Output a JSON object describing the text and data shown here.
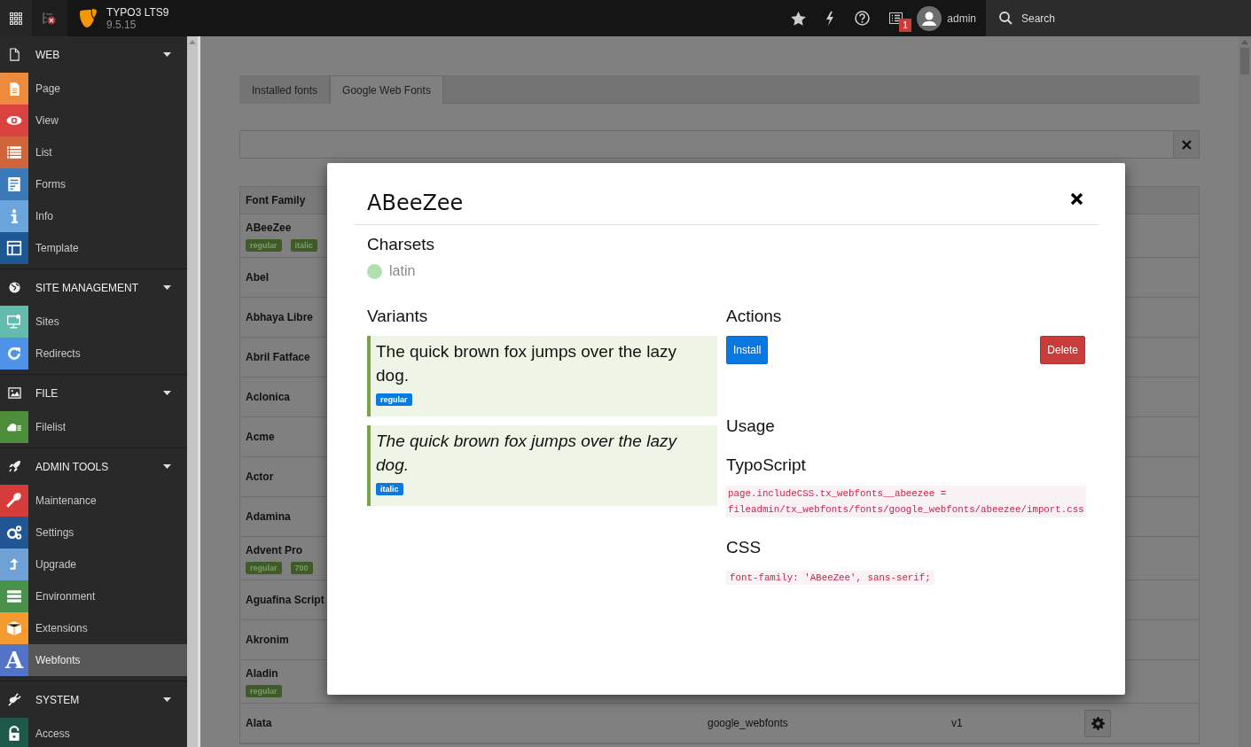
{
  "topbar": {
    "app_title": "TYPO3 LTS9",
    "version": "9.5.15",
    "notification_count": "1",
    "user": "admin",
    "search_label": "Search"
  },
  "sidebar": {
    "groups": [
      {
        "label": "WEB",
        "expanded": true,
        "items": [
          {
            "label": "Page",
            "selected": false,
            "color": "#ee8a3b"
          },
          {
            "label": "View",
            "selected": false,
            "color": "#d9423f"
          },
          {
            "label": "List",
            "selected": false,
            "color": "#d0653c"
          },
          {
            "label": "Forms",
            "selected": false,
            "color": "#3a7ab8"
          },
          {
            "label": "Info",
            "selected": false,
            "color": "#6aa5dd"
          },
          {
            "label": "Template",
            "selected": false,
            "color": "#1d5895"
          }
        ]
      },
      {
        "label": "SITE MANAGEMENT",
        "expanded": true,
        "items": [
          {
            "label": "Sites",
            "selected": false,
            "color": "#63bbad"
          },
          {
            "label": "Redirects",
            "selected": false,
            "color": "#4f93e8"
          }
        ]
      },
      {
        "label": "FILE",
        "expanded": true,
        "items": [
          {
            "label": "Filelist",
            "selected": false,
            "color": "#4e8d3a"
          }
        ]
      },
      {
        "label": "ADMIN TOOLS",
        "expanded": true,
        "items": [
          {
            "label": "Maintenance",
            "selected": false,
            "color": "#d63d3a"
          },
          {
            "label": "Settings",
            "selected": false,
            "color": "#1f5693"
          },
          {
            "label": "Upgrade",
            "selected": false,
            "color": "#6ea2d6"
          },
          {
            "label": "Environment",
            "selected": false,
            "color": "#4a924c"
          },
          {
            "label": "Extensions",
            "selected": false,
            "color": "#f39a30"
          },
          {
            "label": "Webfonts",
            "selected": true,
            "color": "#5273c7",
            "glyph": "A"
          }
        ]
      },
      {
        "label": "SYSTEM",
        "expanded": true,
        "items": [
          {
            "label": "Access",
            "selected": false,
            "color": "#1d5848"
          }
        ]
      }
    ]
  },
  "tabs": [
    {
      "label": "Installed fonts",
      "selected": false
    },
    {
      "label": "Google Web Fonts",
      "selected": true
    }
  ],
  "table": {
    "columns": [
      "Font Family"
    ],
    "rows": [
      {
        "name": "ABeeZee",
        "variants": [
          "regular",
          "italic"
        ]
      },
      {
        "name": "Abel"
      },
      {
        "name": "Abhaya Libre"
      },
      {
        "name": "Abril Fatface"
      },
      {
        "name": "Aclonica"
      },
      {
        "name": "Acme"
      },
      {
        "name": "Actor"
      },
      {
        "name": "Adamina"
      },
      {
        "name": "Advent Pro",
        "variants": [
          "regular",
          "700"
        ]
      },
      {
        "name": "Aguafina Script"
      },
      {
        "name": "Akronim"
      },
      {
        "name": "Aladin",
        "variants": [
          "regular"
        ]
      },
      {
        "name": "Alata",
        "source": "google_webfonts",
        "version": "v1"
      }
    ]
  },
  "modal": {
    "title": "ABeeZee",
    "charsets_heading": "Charsets",
    "charsets": [
      "latin"
    ],
    "variants_heading": "Variants",
    "variants": [
      {
        "kind": "regular",
        "sample": "The quick brown fox jumps over the lazy dog.",
        "badge": "regular"
      },
      {
        "kind": "italic",
        "sample": "The quick brown fox jumps over the lazy dog.",
        "badge": "italic"
      }
    ],
    "actions_heading": "Actions",
    "buttons": [
      {
        "kind": "primary",
        "label": "Install"
      },
      {
        "kind": "danger",
        "label": "Delete"
      }
    ],
    "usage_heading": "Usage",
    "typoscript_heading": "TypoScript",
    "typoscript_code": "page.includeCSS.tx_webfonts__abeezee = fileadmin/tx_webfonts/fonts/google_webfonts/abeezee/import.css",
    "css_heading": "CSS",
    "css_code": "font-family: 'ABeeZee', sans-serif;"
  }
}
